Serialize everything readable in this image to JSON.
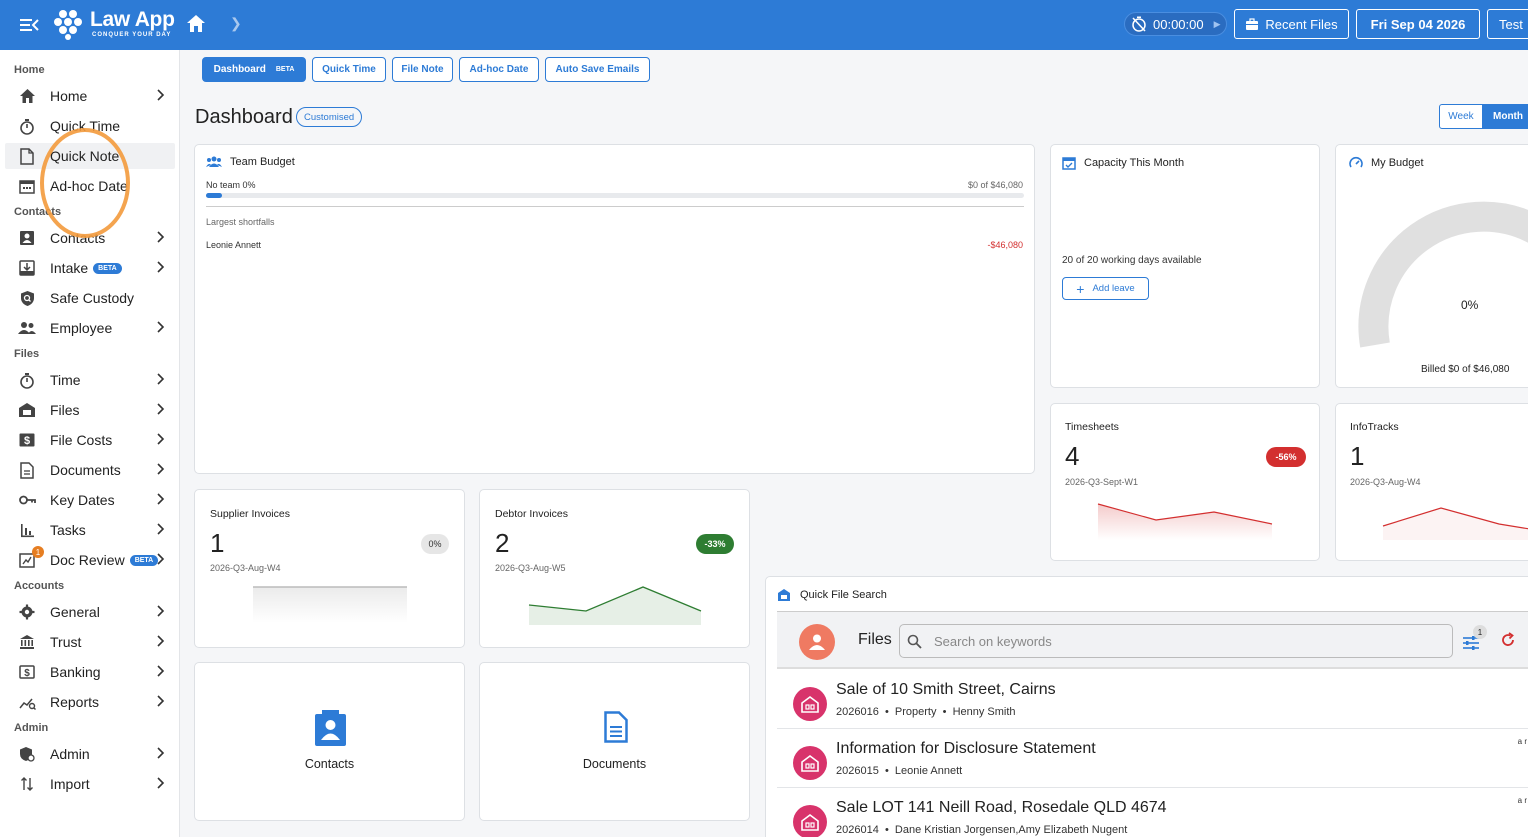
{
  "app": {
    "name": "Law App",
    "tagline": "CONQUER YOUR DAY"
  },
  "header": {
    "timer": "00:00:00",
    "recent_files": "Recent Files",
    "date": "Fri Sep 04 2026",
    "user": "Test",
    "accent": "#2d7bd6"
  },
  "sidebar": {
    "sections": {
      "home": "Home",
      "contacts": "Contacts",
      "files": "Files",
      "accounts": "Accounts",
      "admin": "Admin"
    },
    "items": {
      "home": "Home",
      "quick_time": "Quick Time",
      "quick_note": "Quick Note",
      "adhoc_date": "Ad-hoc Date",
      "contacts": "Contacts",
      "intake": "Intake",
      "safe_custody": "Safe Custody",
      "employee": "Employee",
      "time": "Time",
      "files": "Files",
      "file_costs": "File Costs",
      "documents": "Documents",
      "key_dates": "Key Dates",
      "tasks": "Tasks",
      "doc_review": "Doc Review",
      "general": "General",
      "trust": "Trust",
      "banking": "Banking",
      "reports": "Reports",
      "admin": "Admin",
      "import": "Import"
    },
    "beta": "BETA",
    "doc_review_badge": "1"
  },
  "tabs": {
    "dashboard": "Dashboard",
    "dashboard_beta": "BETA",
    "quick_time": "Quick Time",
    "file_note": "File Note",
    "adhoc_date": "Ad-hoc Date",
    "auto_save": "Auto Save Emails"
  },
  "dashboard": {
    "title": "Dashboard",
    "customised": "Customised",
    "week": "Week",
    "month": "Month",
    "team_budget": {
      "title": "Team Budget",
      "no_team": "No team 0%",
      "amount": "$0 of $46,080",
      "progress": 0.01,
      "shortfalls_label": "Largest shortfalls",
      "shortfall_name": "Leonie Annett",
      "shortfall_value": "-$46,080"
    },
    "capacity": {
      "title": "Capacity This Month",
      "available": "20 of 20 working days available",
      "add_leave": "Add leave"
    },
    "my_budget": {
      "title": "My Budget",
      "percent": "0%",
      "billed": "Billed $0 of $46,080"
    },
    "timesheets": {
      "title": "Timesheets",
      "value": "4",
      "period": "2026-Q3-Sept-W1",
      "change": "-56%"
    },
    "infotracks": {
      "title": "InfoTracks",
      "value": "1",
      "period": "2026-Q3-Aug-W4"
    },
    "supplier": {
      "title": "Supplier Invoices",
      "value": "1",
      "period": "2026-Q3-Aug-W4",
      "change": "0%"
    },
    "debtor": {
      "title": "Debtor Invoices",
      "value": "2",
      "period": "2026-Q3-Aug-W5",
      "change": "-33%"
    },
    "contacts_tile": "Contacts",
    "documents_tile": "Documents",
    "quick_search": {
      "title": "Quick File Search",
      "files_label": "Files",
      "placeholder": "Search on keywords",
      "filter_count": "1",
      "results": [
        {
          "title": "Sale of 10 Smith Street, Cairns",
          "number": "2026016",
          "type": "Property",
          "person": "Henny Smith",
          "right": ""
        },
        {
          "title": "Information for Disclosure Statement",
          "number": "2026015",
          "type": "",
          "person": "Leonie Annett",
          "right": "a r"
        },
        {
          "title": "Sale LOT 141 Neill Road, Rosedale QLD 4674",
          "number": "2026014",
          "type": "",
          "person": "Dane Kristian Jorgensen,Amy Elizabeth Nugent",
          "right": "a r"
        }
      ]
    }
  }
}
